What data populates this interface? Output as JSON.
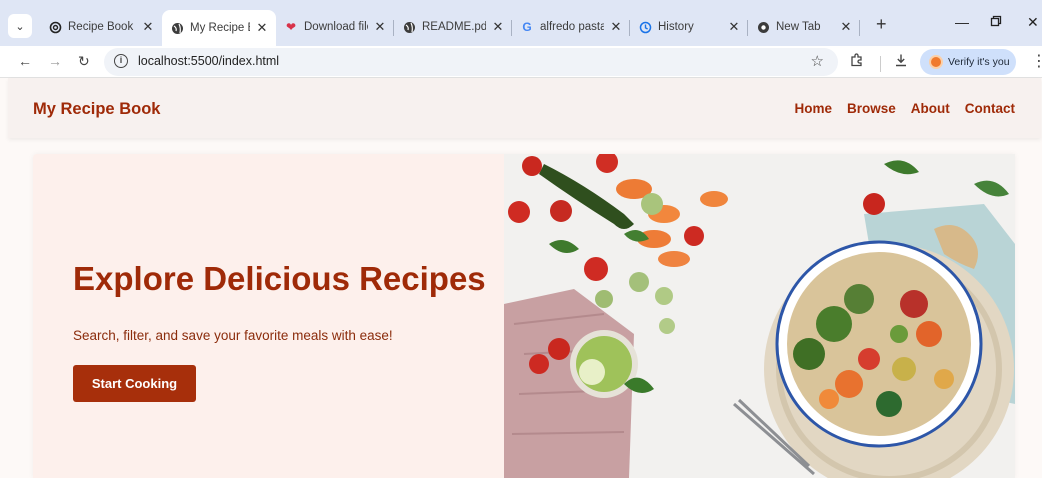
{
  "browser": {
    "tab_search_icon": "chevron-down-icon",
    "tabs": [
      {
        "title": "Recipe Book V",
        "icon": "openai-icon",
        "active": false
      },
      {
        "title": "My Recipe Bo",
        "icon": "globe-icon",
        "active": true
      },
      {
        "title": "Download file",
        "icon": "heart-icon",
        "active": false
      },
      {
        "title": "README.pdf",
        "icon": "globe-icon",
        "active": false
      },
      {
        "title": "alfredo pasta",
        "icon": "google-icon",
        "active": false
      },
      {
        "title": "History",
        "icon": "history-icon",
        "active": false
      },
      {
        "title": "New Tab",
        "icon": "chrome-icon",
        "active": false
      }
    ],
    "url": "localhost:5500/index.html",
    "verify_label": "Verify it's you",
    "colors": {
      "strip": "#dfe6f5",
      "omnibox": "#f0f3f8",
      "verify": "#cfe0fb"
    }
  },
  "site": {
    "brand": "My Recipe Book",
    "nav": [
      "Home",
      "Browse",
      "About",
      "Contact"
    ],
    "hero": {
      "title": "Explore Delicious Recipes",
      "subtitle": "Search, filter, and save your favorite meals with ease!",
      "cta_label": "Start Cooking",
      "image_icon": "food-bowl-photo"
    },
    "colors": {
      "accent": "#9f2a08",
      "button": "#a72f0b",
      "hero_bg": "#fdf0ec",
      "header_bg": "#f7f1ef"
    }
  }
}
